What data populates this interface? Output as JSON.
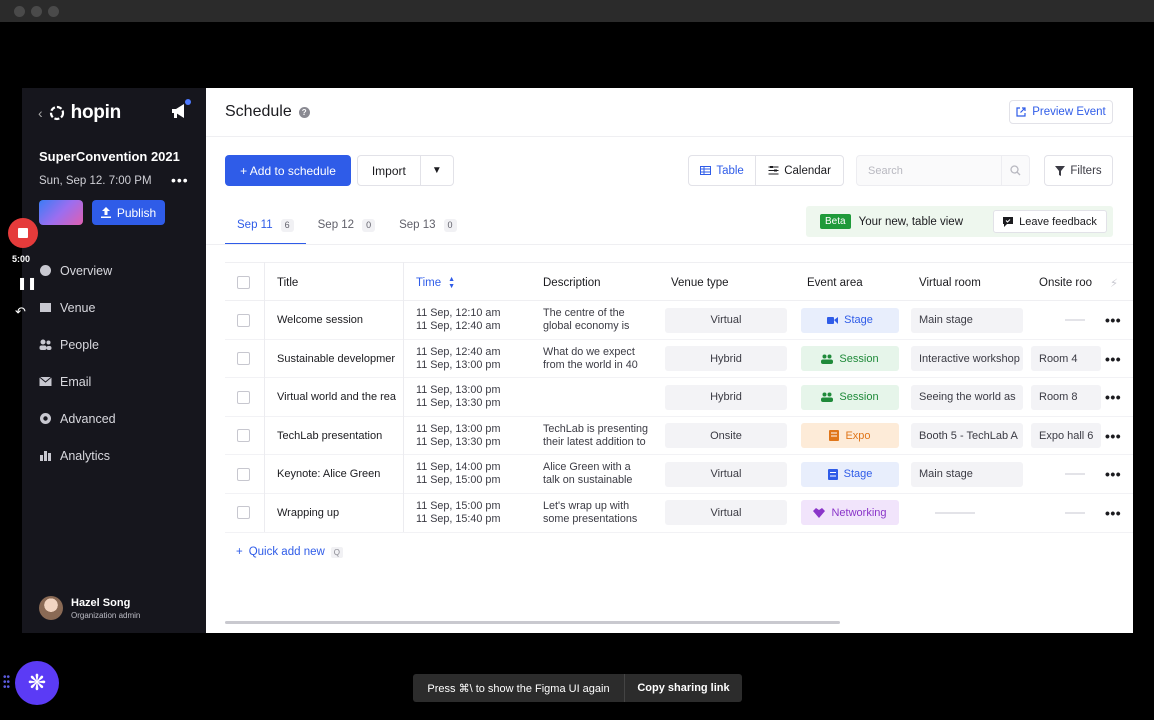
{
  "sidebar": {
    "logo": "hopin",
    "event_name": "SuperConvention 2021",
    "event_date": "Sun, Sep 12. 7:00 PM",
    "publish_label": "Publish",
    "nav": [
      {
        "label": "Overview",
        "icon": "overview-icon"
      },
      {
        "label": "Venue",
        "icon": "venue-icon"
      },
      {
        "label": "People",
        "icon": "people-icon"
      },
      {
        "label": "Email",
        "icon": "email-icon"
      },
      {
        "label": "Advanced",
        "icon": "advanced-icon"
      },
      {
        "label": "Analytics",
        "icon": "analytics-icon"
      }
    ],
    "user": {
      "name": "Hazel Song",
      "role": "Organization admin"
    }
  },
  "header": {
    "title": "Schedule",
    "preview_label": "Preview Event"
  },
  "toolbar": {
    "add_label": "+ Add to schedule",
    "import_label": "Import",
    "table_label": "Table",
    "calendar_label": "Calendar",
    "search_placeholder": "Search",
    "filters_label": "Filters"
  },
  "tabs": [
    {
      "label": "Sep 11",
      "count": "6"
    },
    {
      "label": "Sep 12",
      "count": "0"
    },
    {
      "label": "Sep 13",
      "count": "0"
    }
  ],
  "beta": {
    "badge": "Beta",
    "text": "Your new, table view",
    "feedback_label": "Leave feedback"
  },
  "table": {
    "columns": [
      "Title",
      "Time",
      "Description",
      "Venue type",
      "Event area",
      "Virtual room",
      "Onsite roo"
    ],
    "rows": [
      {
        "title": "Welcome session",
        "time1": "11 Sep, 12:10 am",
        "time2": "11 Sep, 12:40 am",
        "desc1": "The centre of the",
        "desc2": "global economy is",
        "venue": "Virtual",
        "area": "Stage",
        "area_kind": "stage",
        "vroom": "Main stage",
        "oroom": ""
      },
      {
        "title": "Sustainable developmer",
        "time1": "11 Sep, 12:40 am",
        "time2": "11 Sep, 13:00 pm",
        "desc1": "What do we expect",
        "desc2": "from the world in 40",
        "venue": "Hybrid",
        "area": "Session",
        "area_kind": "session",
        "vroom": "Interactive workshop",
        "oroom": "Room 4"
      },
      {
        "title": "Virtual world and the rea",
        "time1": "11 Sep, 13:00 pm",
        "time2": "11 Sep, 13:30 pm",
        "desc1": "",
        "desc2": "",
        "venue": "Hybrid",
        "area": "Session",
        "area_kind": "session",
        "vroom": "Seeing the world as",
        "oroom": "Room 8"
      },
      {
        "title": "TechLab presentation",
        "time1": "11 Sep, 13:00 pm",
        "time2": "11 Sep, 13:30 pm",
        "desc1": "TechLab is presenting",
        "desc2": "their latest addition to",
        "venue": "Onsite",
        "area": "Expo",
        "area_kind": "expo",
        "vroom": "Booth 5 - TechLab A",
        "oroom": "Expo hall 6"
      },
      {
        "title": "Keynote: Alice Green",
        "time1": "11 Sep, 14:00 pm",
        "time2": "11 Sep, 15:00 pm",
        "desc1": "Alice Green with a",
        "desc2": "talk on sustainable",
        "venue": "Virtual",
        "area": "Stage",
        "area_kind": "stage",
        "vroom": "Main stage",
        "oroom": ""
      },
      {
        "title": "Wrapping up",
        "time1": "11 Sep, 15:00 pm",
        "time2": "11 Sep, 15:40 pm",
        "desc1": "Let's wrap up with",
        "desc2": "some presentations",
        "venue": "Virtual",
        "area": "Networking",
        "area_kind": "networking",
        "vroom": "",
        "oroom": ""
      }
    ]
  },
  "quick_add": {
    "label": "Quick add new",
    "shortcut": "Q"
  },
  "recorder": {
    "time": "5:00"
  },
  "figma": {
    "message": "Press ⌘\\ to show the Figma UI again",
    "link_label": "Copy sharing link"
  },
  "colors": {
    "accent": "#2f5ce8",
    "stage_bg": "#e8eefc",
    "stage_fg": "#2f5ce8",
    "session_bg": "#e6f5ea",
    "session_fg": "#1f8a3a",
    "expo_bg": "#fdebd8",
    "expo_fg": "#e0761a",
    "networking_bg": "#f1e4fb",
    "networking_fg": "#8a35c9"
  }
}
